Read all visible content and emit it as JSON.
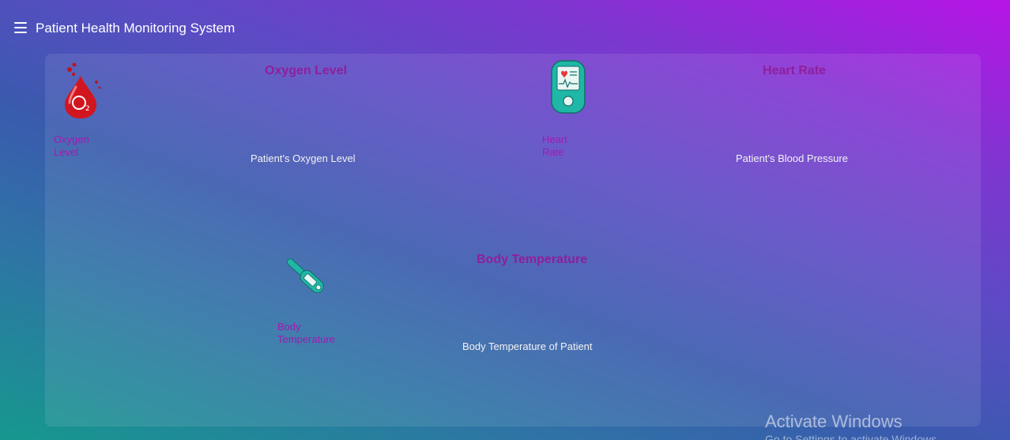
{
  "header": {
    "menu_icon": "hamburger-menu-icon",
    "title": "Patient Health Monitoring System"
  },
  "tiles": [
    {
      "icon": "oxygen-blood-drop-icon",
      "label": "Oxygen Level",
      "heading": "Oxygen Level",
      "description": "Patient's Oxygen Level"
    },
    {
      "icon": "heart-rate-monitor-icon",
      "label": "Heart Rate",
      "heading": "Heart Rate",
      "description": "Patient's Blood Pressure"
    },
    {
      "icon": "thermometer-icon",
      "label": "Body Temperature",
      "heading": "Body Temperature",
      "description": "Body Temperature of Patient"
    }
  ],
  "watermark": {
    "title": "Activate Windows",
    "subtitle": "Go to Settings to activate Windows."
  },
  "colors": {
    "heading": "#8f1f9c",
    "label": "#a01bb0",
    "description": "#f2f2f2",
    "gradient_start": "#b714e6",
    "gradient_end": "#16988e"
  }
}
